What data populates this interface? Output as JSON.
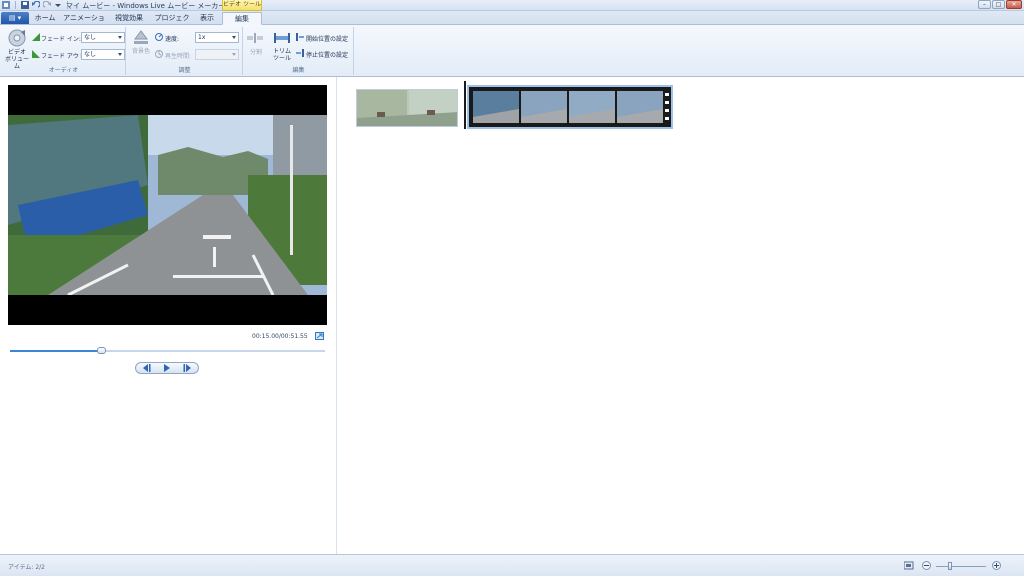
{
  "window": {
    "title": "マイ ムービー - Windows Live ムービー メーカー",
    "context_tab_header": "ビデオ ツール"
  },
  "tabs": {
    "file": "▤ ▾",
    "items": [
      "ホーム",
      "アニメーション",
      "視覚効果",
      "プロジェクト",
      "表示",
      "編集"
    ],
    "active_index": 5
  },
  "ribbon": {
    "audio": {
      "video_volume": "ビデオ\nボリューム",
      "fade_in_label": "フェード イン:",
      "fade_in_value": "なし",
      "fade_out_label": "フェード アウト:",
      "fade_out_value": "なし",
      "group_label": "オーディオ"
    },
    "adjust": {
      "bg_color": "背景色",
      "speed_label": "速度:",
      "speed_value": "1x",
      "duration_label": "再生時間:",
      "duration_value": "",
      "group_label": "調整"
    },
    "edit": {
      "split": "分割",
      "trim_tool": "トリム\nツール",
      "set_start": "開始位置の設定",
      "set_end": "停止位置の設定",
      "group_label": "編集"
    }
  },
  "preview": {
    "time_readout": "00:15.00/00:51.55",
    "seek_position_fraction": 0.29
  },
  "status": {
    "items_text": "アイテム: 2/2"
  },
  "colors": {
    "accent": "#3c86d8",
    "file_button": "#1f56a8",
    "context_tab": "#f5e06a"
  }
}
